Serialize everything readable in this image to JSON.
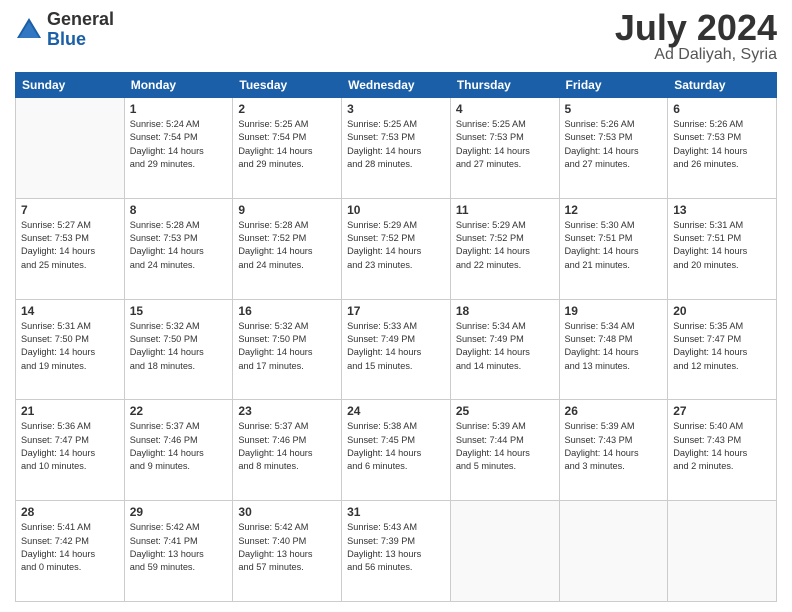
{
  "header": {
    "logo_general": "General",
    "logo_blue": "Blue",
    "title": "July 2024",
    "location": "Ad Daliyah, Syria"
  },
  "weekdays": [
    "Sunday",
    "Monday",
    "Tuesday",
    "Wednesday",
    "Thursday",
    "Friday",
    "Saturday"
  ],
  "weeks": [
    [
      {
        "day": "",
        "info": ""
      },
      {
        "day": "1",
        "info": "Sunrise: 5:24 AM\nSunset: 7:54 PM\nDaylight: 14 hours\nand 29 minutes."
      },
      {
        "day": "2",
        "info": "Sunrise: 5:25 AM\nSunset: 7:54 PM\nDaylight: 14 hours\nand 29 minutes."
      },
      {
        "day": "3",
        "info": "Sunrise: 5:25 AM\nSunset: 7:53 PM\nDaylight: 14 hours\nand 28 minutes."
      },
      {
        "day": "4",
        "info": "Sunrise: 5:25 AM\nSunset: 7:53 PM\nDaylight: 14 hours\nand 27 minutes."
      },
      {
        "day": "5",
        "info": "Sunrise: 5:26 AM\nSunset: 7:53 PM\nDaylight: 14 hours\nand 27 minutes."
      },
      {
        "day": "6",
        "info": "Sunrise: 5:26 AM\nSunset: 7:53 PM\nDaylight: 14 hours\nand 26 minutes."
      }
    ],
    [
      {
        "day": "7",
        "info": "Sunrise: 5:27 AM\nSunset: 7:53 PM\nDaylight: 14 hours\nand 25 minutes."
      },
      {
        "day": "8",
        "info": "Sunrise: 5:28 AM\nSunset: 7:53 PM\nDaylight: 14 hours\nand 24 minutes."
      },
      {
        "day": "9",
        "info": "Sunrise: 5:28 AM\nSunset: 7:52 PM\nDaylight: 14 hours\nand 24 minutes."
      },
      {
        "day": "10",
        "info": "Sunrise: 5:29 AM\nSunset: 7:52 PM\nDaylight: 14 hours\nand 23 minutes."
      },
      {
        "day": "11",
        "info": "Sunrise: 5:29 AM\nSunset: 7:52 PM\nDaylight: 14 hours\nand 22 minutes."
      },
      {
        "day": "12",
        "info": "Sunrise: 5:30 AM\nSunset: 7:51 PM\nDaylight: 14 hours\nand 21 minutes."
      },
      {
        "day": "13",
        "info": "Sunrise: 5:31 AM\nSunset: 7:51 PM\nDaylight: 14 hours\nand 20 minutes."
      }
    ],
    [
      {
        "day": "14",
        "info": "Sunrise: 5:31 AM\nSunset: 7:50 PM\nDaylight: 14 hours\nand 19 minutes."
      },
      {
        "day": "15",
        "info": "Sunrise: 5:32 AM\nSunset: 7:50 PM\nDaylight: 14 hours\nand 18 minutes."
      },
      {
        "day": "16",
        "info": "Sunrise: 5:32 AM\nSunset: 7:50 PM\nDaylight: 14 hours\nand 17 minutes."
      },
      {
        "day": "17",
        "info": "Sunrise: 5:33 AM\nSunset: 7:49 PM\nDaylight: 14 hours\nand 15 minutes."
      },
      {
        "day": "18",
        "info": "Sunrise: 5:34 AM\nSunset: 7:49 PM\nDaylight: 14 hours\nand 14 minutes."
      },
      {
        "day": "19",
        "info": "Sunrise: 5:34 AM\nSunset: 7:48 PM\nDaylight: 14 hours\nand 13 minutes."
      },
      {
        "day": "20",
        "info": "Sunrise: 5:35 AM\nSunset: 7:47 PM\nDaylight: 14 hours\nand 12 minutes."
      }
    ],
    [
      {
        "day": "21",
        "info": "Sunrise: 5:36 AM\nSunset: 7:47 PM\nDaylight: 14 hours\nand 10 minutes."
      },
      {
        "day": "22",
        "info": "Sunrise: 5:37 AM\nSunset: 7:46 PM\nDaylight: 14 hours\nand 9 minutes."
      },
      {
        "day": "23",
        "info": "Sunrise: 5:37 AM\nSunset: 7:46 PM\nDaylight: 14 hours\nand 8 minutes."
      },
      {
        "day": "24",
        "info": "Sunrise: 5:38 AM\nSunset: 7:45 PM\nDaylight: 14 hours\nand 6 minutes."
      },
      {
        "day": "25",
        "info": "Sunrise: 5:39 AM\nSunset: 7:44 PM\nDaylight: 14 hours\nand 5 minutes."
      },
      {
        "day": "26",
        "info": "Sunrise: 5:39 AM\nSunset: 7:43 PM\nDaylight: 14 hours\nand 3 minutes."
      },
      {
        "day": "27",
        "info": "Sunrise: 5:40 AM\nSunset: 7:43 PM\nDaylight: 14 hours\nand 2 minutes."
      }
    ],
    [
      {
        "day": "28",
        "info": "Sunrise: 5:41 AM\nSunset: 7:42 PM\nDaylight: 14 hours\nand 0 minutes."
      },
      {
        "day": "29",
        "info": "Sunrise: 5:42 AM\nSunset: 7:41 PM\nDaylight: 13 hours\nand 59 minutes."
      },
      {
        "day": "30",
        "info": "Sunrise: 5:42 AM\nSunset: 7:40 PM\nDaylight: 13 hours\nand 57 minutes."
      },
      {
        "day": "31",
        "info": "Sunrise: 5:43 AM\nSunset: 7:39 PM\nDaylight: 13 hours\nand 56 minutes."
      },
      {
        "day": "",
        "info": ""
      },
      {
        "day": "",
        "info": ""
      },
      {
        "day": "",
        "info": ""
      }
    ]
  ]
}
